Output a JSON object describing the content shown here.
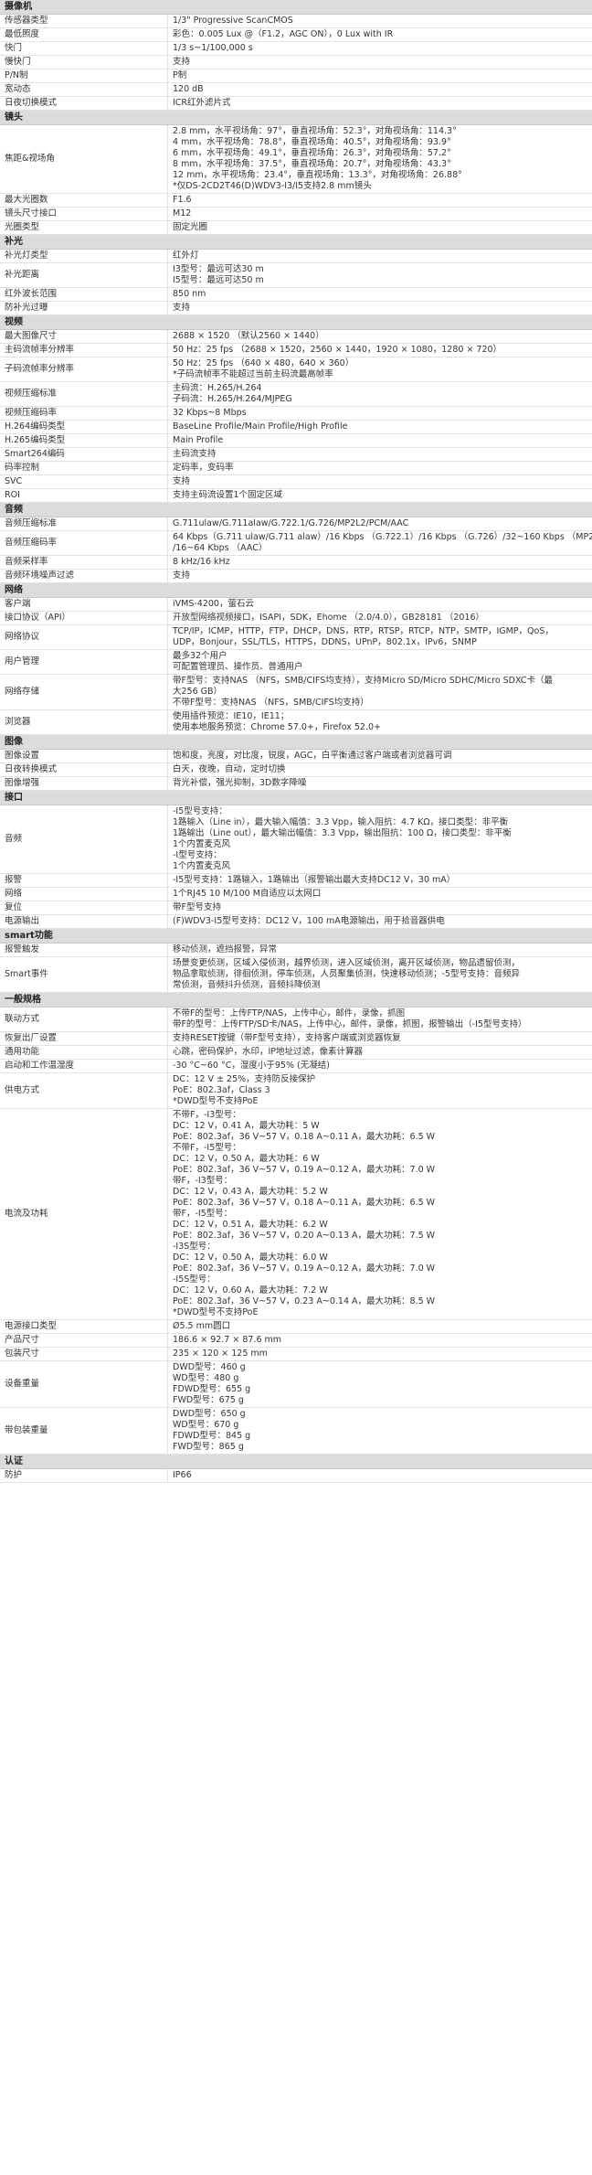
{
  "sections": [
    {
      "title": "摄像机",
      "rows": [
        {
          "k": "传感器类型",
          "v": [
            "1/3\" Progressive ScanCMOS"
          ]
        },
        {
          "k": "最低照度",
          "v": [
            "彩色：0.005 Lux @（F1.2，AGC ON），0 Lux with IR"
          ]
        },
        {
          "k": "快门",
          "v": [
            "1/3 s~1/100,000 s"
          ]
        },
        {
          "k": "慢快门",
          "v": [
            "支持"
          ]
        },
        {
          "k": "P/N制",
          "v": [
            "P制"
          ]
        },
        {
          "k": "宽动态",
          "v": [
            "120 dB"
          ]
        },
        {
          "k": "日夜切换模式",
          "v": [
            "ICR红外滤片式"
          ]
        }
      ]
    },
    {
      "title": "镜头",
      "rows": [
        {
          "k": "焦距&视场角",
          "v": [
            "2.8 mm，水平视场角：97°，垂直视场角：52.3°，对角视场角：114.3°",
            "4 mm，水平视场角：78.8°，垂直视场角：40.5°，对角视场角：93.9°",
            "6 mm，水平视场角：49.1°，垂直视场角：26.3°，对角视场角：57.2°",
            "8 mm，水平视场角：37.5°，垂直视场角：20.7°，对角视场角：43.3°",
            "12 mm，水平视场角：23.4°，垂直视场角：13.3°，对角视场角：26.88°",
            "*仅DS-2CD2T46(D)WDV3-I3/I5支持2.8 mm镜头"
          ]
        },
        {
          "k": "最大光圈数",
          "v": [
            "F1.6"
          ]
        },
        {
          "k": "镜头尺寸接口",
          "v": [
            "M12"
          ]
        },
        {
          "k": "光圈类型",
          "v": [
            "固定光圈"
          ]
        }
      ]
    },
    {
      "title": "补光",
      "rows": [
        {
          "k": "补光灯类型",
          "v": [
            "红外灯"
          ]
        },
        {
          "k": "补光距离",
          "v": [
            "I3型号：最远可达30 m",
            "I5型号：最远可达50 m"
          ]
        },
        {
          "k": "红外波长范围",
          "v": [
            "850 nm"
          ]
        },
        {
          "k": "防补光过曝",
          "v": [
            "支持"
          ]
        }
      ]
    },
    {
      "title": "视频",
      "rows": [
        {
          "k": "最大图像尺寸",
          "v": [
            "2688 × 1520 （默认2560 × 1440）"
          ]
        },
        {
          "k": "主码流帧率分辨率",
          "v": [
            "50 Hz：25 fps （2688 × 1520，2560 × 1440，1920 × 1080，1280 × 720）"
          ]
        },
        {
          "k": "子码流帧率分辨率",
          "v": [
            "50 Hz：25 fps （640 × 480，640 × 360）",
            "*子码流帧率不能超过当前主码流最高帧率"
          ]
        },
        {
          "k": "视频压缩标准",
          "v": [
            "主码流：H.265/H.264",
            "子码流：H.265/H.264/MJPEG"
          ]
        },
        {
          "k": "视频压缩码率",
          "v": [
            "32 Kbps~8 Mbps"
          ]
        },
        {
          "k": "H.264编码类型",
          "v": [
            "BaseLine Profile/Main Profile/High Profile"
          ]
        },
        {
          "k": "H.265编码类型",
          "v": [
            "Main Profile"
          ]
        },
        {
          "k": "Smart264编码",
          "v": [
            "主码流支持"
          ]
        },
        {
          "k": "码率控制",
          "v": [
            "定码率，变码率"
          ]
        },
        {
          "k": "SVC",
          "v": [
            "支持"
          ]
        },
        {
          "k": "ROI",
          "v": [
            "支持主码流设置1个固定区域"
          ]
        }
      ]
    },
    {
      "title": "音频",
      "rows": [
        {
          "k": "音频压缩标准",
          "v": [
            "G.711ulaw/G.711alaw/G.722.1/G.726/MP2L2/PCM/AAC"
          ]
        },
        {
          "k": "音频压缩码率",
          "v": [
            "64 Kbps（G.711 ulaw/G.711 alaw）/16 Kbps （G.722.1）/16 Kbps （G.726）/32~160 Kbps （MP2L2）",
            "/16~64 Kbps （AAC）"
          ]
        },
        {
          "k": "音频采样率",
          "v": [
            "8 kHz/16 kHz"
          ]
        },
        {
          "k": "音频环境噪声过滤",
          "v": [
            "支持"
          ]
        }
      ]
    },
    {
      "title": "网络",
      "rows": [
        {
          "k": "客户端",
          "v": [
            "iVMS-4200，萤石云"
          ]
        },
        {
          "k": "接口协议（API）",
          "v": [
            "开放型网络视频接口，ISAPI，SDK，Ehome （2.0/4.0），GB28181 （2016）"
          ]
        },
        {
          "k": "网络协议",
          "v": [
            "TCP/IP，ICMP，HTTP，FTP，DHCP，DNS，RTP，RTSP，RTCP，NTP，SMTP，IGMP，QoS，",
            "UDP，Bonjour，SSL/TLS，HTTPS，DDNS，UPnP，802.1x，IPv6，SNMP"
          ]
        },
        {
          "k": "用户管理",
          "v": [
            "最多32个用户",
            "可配置管理员、操作员、普通用户"
          ]
        },
        {
          "k": "网络存储",
          "v": [
            "带F型号：支持NAS （NFS，SMB/CIFS均支持），支持Micro SD/Micro SDHC/Micro SDXC卡（最",
            "大256 GB）",
            "不带F型号：支持NAS （NFS，SMB/CIFS均支持）"
          ]
        },
        {
          "k": "浏览器",
          "v": [
            "使用插件预览：IE10，IE11；",
            "使用本地服务预览：Chrome 57.0+，Firefox 52.0+"
          ]
        }
      ]
    },
    {
      "title": "图像",
      "rows": [
        {
          "k": "图像设置",
          "v": [
            "饱和度，亮度，对比度，锐度，AGC，白平衡通过客户端或者浏览器可调"
          ]
        },
        {
          "k": "日夜转换模式",
          "v": [
            "白天，夜晚，自动，定时切换"
          ]
        },
        {
          "k": "图像增强",
          "v": [
            "背光补偿，强光抑制，3D数字降噪"
          ]
        }
      ]
    },
    {
      "title": "接口",
      "rows": [
        {
          "k": "音频",
          "v": [
            "-I5型号支持：",
            "1路输入（Line in），最大输入幅值：3.3 Vpp，输入阻抗：4.7 KΩ，接口类型：非平衡",
            "1路输出（Line out），最大输出幅值：3.3 Vpp，输出阻抗：100 Ω，接口类型：非平衡",
            "1个内置麦克风",
            "-I型号支持：",
            "1个内置麦克风"
          ]
        },
        {
          "k": "报警",
          "v": [
            "-I5型号支持：1路输入，1路输出（报警输出最大支持DC12 V，30 mA）"
          ]
        },
        {
          "k": "网络",
          "v": [
            "1个RJ45 10 M/100 M自适应以太网口"
          ]
        },
        {
          "k": "复位",
          "v": [
            "带F型号支持"
          ]
        },
        {
          "k": "电源输出",
          "v": [
            "(F)WDV3-I5型号支持：DC12 V，100 mA电源输出，用于拾音器供电"
          ]
        }
      ]
    },
    {
      "title": "smart功能",
      "rows": [
        {
          "k": "报警触发",
          "v": [
            "移动侦测，遮挡报警，异常"
          ]
        },
        {
          "k": "Smart事件",
          "v": [
            "场景变更侦测，区域入侵侦测，越界侦测，进入区域侦测，离开区域侦测，物品遗留侦测，",
            "物品拿取侦测，徘徊侦测，停车侦测，人员聚集侦测，快速移动侦测；-5型号支持：音频异",
            "常侦测，音频抖升侦测，音频抖降侦测"
          ]
        }
      ]
    },
    {
      "title": "一般规格",
      "rows": [
        {
          "k": "联动方式",
          "v": [
            "不带F的型号：上传FTP/NAS，上传中心，邮件，录像，抓图",
            "带F的型号：上传FTP/SD卡/NAS，上传中心，邮件，录像，抓图，报警输出（-I5型号支持）"
          ]
        },
        {
          "k": "恢复出厂设置",
          "v": [
            "支持RESET按键（带F型号支持），支持客户端或浏览器恢复"
          ]
        },
        {
          "k": "通用功能",
          "v": [
            "心跳，密码保护，水印，IP地址过滤，像素计算器"
          ]
        },
        {
          "k": "启动和工作温湿度",
          "v": [
            "-30 °C~60 °C，湿度小于95% (无凝结)"
          ]
        },
        {
          "k": "供电方式",
          "v": [
            "DC：12 V ± 25%，支持防反接保护",
            "PoE：802.3af，Class 3",
            "*DWD型号不支持PoE"
          ]
        },
        {
          "k": "电流及功耗",
          "v": [
            "不带F，-I3型号：",
            "DC：12 V，0.41 A，最大功耗：5 W",
            "PoE：802.3af，36 V~57 V，0.18 A~0.11 A，最大功耗：6.5 W",
            "不带F，-I5型号：",
            "DC：12 V，0.50 A，最大功耗：6 W",
            "PoE：802.3af，36 V~57 V，0.19 A~0.12 A，最大功耗：7.0 W",
            "带F，-I3型号：",
            "DC：12 V，0.43 A，最大功耗：5.2 W",
            "PoE：802.3af，36 V~57 V，0.18 A~0.11 A，最大功耗：6.5 W",
            "带F，-I5型号：",
            "DC：12 V，0.51 A，最大功耗：6.2 W",
            "PoE：802.3af，36 V~57 V，0.20 A~0.13 A，最大功耗：7.5 W",
            "-I3S型号：",
            "DC：12 V，0.50 A，最大功耗：6.0 W",
            "PoE：802.3af，36 V~57 V，0.19 A~0.12 A，最大功耗：7.0 W",
            "-I5S型号：",
            "DC：12 V，0.60 A，最大功耗：7.2 W",
            "PoE：802.3af，36 V~57 V，0.23 A~0.14 A，最大功耗：8.5 W",
            "*DWD型号不支持PoE"
          ]
        },
        {
          "k": "电源接口类型",
          "v": [
            "Ø5.5 mm圆口"
          ]
        },
        {
          "k": "产品尺寸",
          "v": [
            "186.6 × 92.7 × 87.6 mm"
          ]
        },
        {
          "k": "包装尺寸",
          "v": [
            "235 × 120 × 125 mm"
          ]
        },
        {
          "k": "设备重量",
          "v": [
            "DWD型号：460 g",
            "WD型号：480 g",
            "FDWD型号：655 g",
            "FWD型号：675 g"
          ]
        },
        {
          "k": "带包装重量",
          "v": [
            "DWD型号：650 g",
            "WD型号：670 g",
            "FDWD型号：845 g",
            "FWD型号：865 g"
          ]
        }
      ]
    },
    {
      "title": "认证",
      "rows": [
        {
          "k": "防护",
          "v": [
            "IP66"
          ]
        }
      ]
    }
  ]
}
